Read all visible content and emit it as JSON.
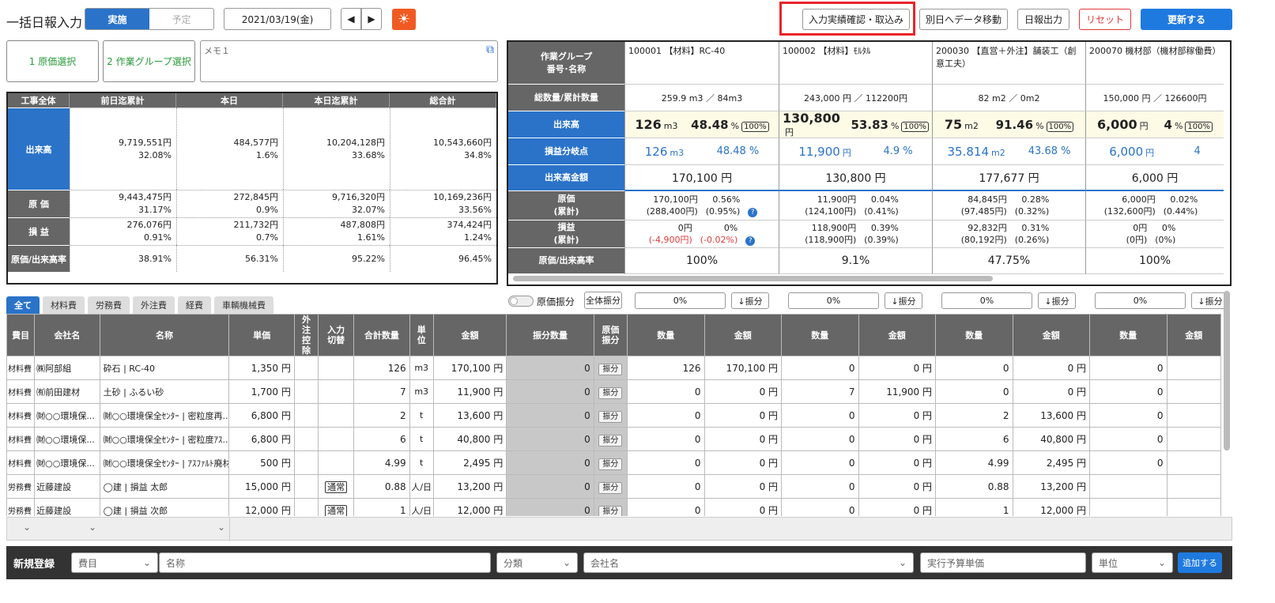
{
  "header": {
    "title": "一括日報入力",
    "mode_active": "実施",
    "mode_inactive": "予定",
    "date": "2021/03/19(金)",
    "buttons": {
      "confirm": "入力実績確認・取込み",
      "move": "別日へデータ移動",
      "output": "日報出力",
      "reset": "リセット",
      "update": "更新する"
    }
  },
  "left": {
    "cost_btn": "1 原価選択",
    "group_btn": "2 作業グループ選択",
    "memo_placeholder": "メモ１",
    "summary": {
      "cols": [
        "工事全体",
        "前日迄累計",
        "本日",
        "本日迄累計",
        "総合計"
      ],
      "rows": [
        {
          "label": "出来高",
          "cells": [
            [
              "9,719,551円",
              "32.08%"
            ],
            [
              "484,577円",
              "1.6%"
            ],
            [
              "10,204,128円",
              "33.68%"
            ],
            [
              "10,543,660円",
              "34.8%"
            ]
          ]
        },
        {
          "label": "原 価",
          "cells": [
            [
              "9,443,475円",
              "31.17%"
            ],
            [
              "272,845円",
              "0.9%"
            ],
            [
              "9,716,320円",
              "32.07%"
            ],
            [
              "10,169,236円",
              "33.56%"
            ]
          ]
        },
        {
          "label": "損 益",
          "cells": [
            [
              "276,076円",
              "0.91%"
            ],
            [
              "211,732円",
              "0.7%"
            ],
            [
              "487,808円",
              "1.61%"
            ],
            [
              "374,424円",
              "1.24%"
            ]
          ]
        },
        {
          "label": "原価/出来高率",
          "cells": [
            [
              "38.91%"
            ],
            [
              "56.31%"
            ],
            [
              "95.22%"
            ],
            [
              "96.45%"
            ]
          ]
        }
      ]
    }
  },
  "groups": {
    "row_labels": [
      "作業グループ\n番号･名称",
      "総数量/累計数量",
      "出来高",
      "損益分岐点",
      "出来高金額",
      "原価\n(累計)",
      "損益\n(累計)",
      "原価/出来高率"
    ],
    "cols": [
      {
        "name": "100001 【材料】RC-40",
        "total": "259.9 m3 ／ 84m3",
        "dq": "126",
        "du": "m3",
        "dp": "48.48",
        "pct": "100%",
        "bq": "126",
        "bu": "m3",
        "bp": "48.48 %",
        "amount": "170,100 円",
        "cost": [
          "170,100円",
          "0.56%",
          "(288,400円)",
          "(0.95%)"
        ],
        "profit": [
          "0円",
          "0%",
          "(-4,900円)",
          "(-0.02%)"
        ],
        "ratio": "100%"
      },
      {
        "name": "100002 【材料】ﾓﾙﾀﾙ",
        "total": "243,000 円 ／ 112200円",
        "dq": "130,800",
        "du": "円",
        "dp": "53.83",
        "pct": "100%",
        "bq": "11,900",
        "bu": "円",
        "bp": "4.9 %",
        "amount": "130,800 円",
        "cost": [
          "11,900円",
          "0.04%",
          "(124,100円)",
          "(0.41%)"
        ],
        "profit": [
          "118,900円",
          "0.39%",
          "(118,900円)",
          "(0.39%)"
        ],
        "ratio": "9.1%"
      },
      {
        "name": "200030 【直営＋外注】舗装工（創意工夫）",
        "total": "82 m2 ／ 0m2",
        "dq": "75",
        "du": "m2",
        "dp": "91.46",
        "pct": "100%",
        "bq": "35.814",
        "bu": "m2",
        "bp": "43.68 %",
        "amount": "177,677 円",
        "cost": [
          "84,845円",
          "0.28%",
          "(97,485円)",
          "(0.32%)"
        ],
        "profit": [
          "92,832円",
          "0.31%",
          "(80,192円)",
          "(0.26%)"
        ],
        "ratio": "47.75%"
      },
      {
        "name": "200070 機材部（機材部稼働費）",
        "total": "150,000 円 ／ 126600円",
        "dq": "6,000",
        "du": "円",
        "dp": "4",
        "pct": "100%",
        "bq": "6,000",
        "bu": "円",
        "bp": "4",
        "amount": "6,000 円",
        "cost": [
          "6,000円",
          "0.02%",
          "(132,600円)",
          "(0.44%)"
        ],
        "profit": [
          "0円",
          "0%",
          "(0円)",
          "(0%)"
        ],
        "ratio": "100%"
      }
    ]
  },
  "tabs": [
    "全て",
    "材料費",
    "労務費",
    "外注費",
    "経費",
    "車輌機械費"
  ],
  "toggle": "原価振分",
  "all_alloc": "全体振分",
  "alloc_pct": "0%",
  "alloc_btn": "↓振分",
  "table": {
    "headers": [
      "費目",
      "会社名",
      "名称",
      "単価",
      "外注\n控除",
      "入力\n切替",
      "合計数量",
      "単位",
      "金額",
      "振分数量",
      "原価\n振分"
    ],
    "sub": [
      "数量",
      "金額"
    ],
    "alloc_label": "振分",
    "rows": [
      {
        "cat": "材料費",
        "co": "㈱阿部組",
        "name": "砕石 | RC-40",
        "price": "1,350 円",
        "sw": "",
        "qty": "126",
        "unit": "m3",
        "amt": "170,100 円",
        "dist": "0",
        "g": [
          [
            "126",
            "170,100 円"
          ],
          [
            "0",
            "0 円"
          ],
          [
            "0",
            "0 円"
          ],
          [
            "0",
            ""
          ]
        ]
      },
      {
        "cat": "材料費",
        "co": "㈲前田建材",
        "name": "土砂 | ふるい砂",
        "price": "1,700 円",
        "sw": "",
        "qty": "7",
        "unit": "m3",
        "amt": "11,900 円",
        "dist": "0",
        "g": [
          [
            "0",
            "0 円"
          ],
          [
            "7",
            "11,900 円"
          ],
          [
            "0",
            "0 円"
          ],
          [
            "0",
            ""
          ]
        ]
      },
      {
        "cat": "材料費",
        "co": "㈶○○環境保...",
        "name": "㈶○○環境保全ｾﾝﾀｰ | 密粒度再...",
        "price": "6,800 円",
        "sw": "",
        "qty": "2",
        "unit": "t",
        "amt": "13,600 円",
        "dist": "0",
        "g": [
          [
            "0",
            "0 円"
          ],
          [
            "0",
            "0 円"
          ],
          [
            "2",
            "13,600 円"
          ],
          [
            "0",
            ""
          ]
        ]
      },
      {
        "cat": "材料費",
        "co": "㈶○○環境保...",
        "name": "㈶○○環境保全ｾﾝﾀｰ | 密粒度ｱｽ...",
        "price": "6,800 円",
        "sw": "",
        "qty": "6",
        "unit": "t",
        "amt": "40,800 円",
        "dist": "0",
        "g": [
          [
            "0",
            "0 円"
          ],
          [
            "0",
            "0 円"
          ],
          [
            "6",
            "40,800 円"
          ],
          [
            "0",
            ""
          ]
        ]
      },
      {
        "cat": "材料費",
        "co": "㈶○○環境保...",
        "name": "㈶○○環境保全ｾﾝﾀｰ | ｱｽﾌｧﾙﾄ廃材",
        "price": "500 円",
        "sw": "",
        "qty": "4.99",
        "unit": "t",
        "amt": "2,495 円",
        "dist": "0",
        "g": [
          [
            "0",
            "0 円"
          ],
          [
            "0",
            "0 円"
          ],
          [
            "4.99",
            "2,495 円"
          ],
          [
            "0",
            ""
          ]
        ]
      },
      {
        "cat": "労務費",
        "co": "近藤建設",
        "name": "◯建 | 損益 太郎",
        "price": "15,000 円",
        "sw": "通常",
        "qty": "0.88",
        "unit": "人/日",
        "amt": "13,200 円",
        "dist": "0",
        "g": [
          [
            "0",
            "0 円"
          ],
          [
            "0",
            "0 円"
          ],
          [
            "0.88",
            "13,200 円"
          ],
          [
            "",
            ""
          ]
        ]
      },
      {
        "cat": "労務費",
        "co": "近藤建設",
        "name": "◯建 | 損益 次郎",
        "price": "12,000 円",
        "sw": "通常",
        "qty": "1",
        "unit": "人/日",
        "amt": "12,000 円",
        "dist": "0",
        "g": [
          [
            "0",
            "0 円"
          ],
          [
            "0",
            "0 円"
          ],
          [
            "1",
            "12,000 円"
          ],
          [
            "",
            ""
          ]
        ]
      }
    ]
  },
  "new_reg": {
    "label": "新規登録",
    "cat": "費目",
    "name": "名称",
    "cls": "分類",
    "co": "会社名",
    "price": "実行予算単価",
    "unit": "単位",
    "add": "追加する"
  }
}
